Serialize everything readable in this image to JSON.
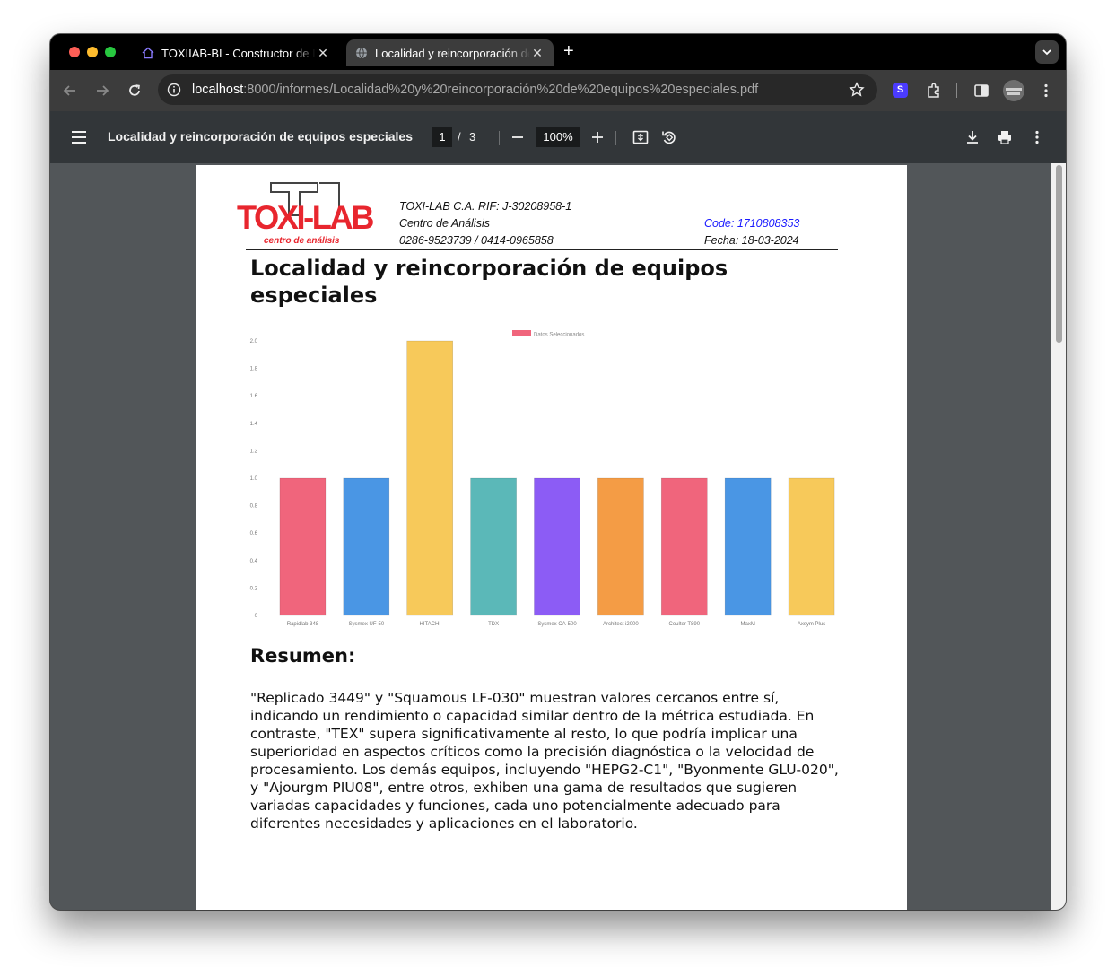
{
  "browser": {
    "tabs": [
      {
        "title": "TOXIIAB-BI - Constructor de I",
        "close": "✕"
      },
      {
        "title": "Localidad y reincorporación de equipos especiales",
        "close": "✕"
      }
    ],
    "new_tab": "+",
    "url_host": "localhost",
    "url_rest": ":8000/informes/Localidad%20y%20reincorporación%20de%20equipos%20especiales.pdf"
  },
  "pdf_toolbar": {
    "title": "Localidad y reincorporación de equipos especiales",
    "page_current": "1",
    "page_sep": "/",
    "page_total": "3",
    "zoom": "100%"
  },
  "document": {
    "logo_text": "TOXI-LAB",
    "logo_sub": "centro de análisis",
    "company_line": "TOXI-LAB C.A. RIF: J-30208958-1",
    "center_line": "Centro de Análisis",
    "phones": "0286-9523739 / 0414-0965858",
    "code": "Code: 1710808353",
    "date": "Fecha: 18-03-2024",
    "heading": "Localidad y reincorporación de equipos especiales",
    "summary_heading": "Resumen:",
    "summary_text": "\"Replicado 3449\" y \"Squamous LF-030\" muestran valores cercanos entre sí, indicando un rendimiento o capacidad similar dentro de la métrica estudiada. En contraste, \"TEX\" supera significativamente al resto, lo que podría implicar una superioridad en aspectos críticos como la precisión diagnóstica o la velocidad de procesamiento. Los demás equipos, incluyendo \"HEPG2-C1\", \"Byonmente GLU-020\", y \"Ajourgm PIU08\", entre otros, exhiben una gama de resultados que sugieren variadas capacidades y funciones, cada uno potencialmente adecuado para diferentes necesidades y aplicaciones en el laboratorio."
  },
  "colors": {
    "code_blue": "#1a1aff",
    "logo_red": "#e8262e"
  },
  "chart_data": {
    "type": "bar",
    "legend": "Datos Seleccionados",
    "legend_position": "top",
    "categories": [
      "Rapidlab 348",
      "Sysmex UF-50",
      "HITACHI",
      "TDX",
      "Sysmex CA-500",
      "Architect i2000",
      "Coulter T890",
      "MaxM",
      "Axsym Plus"
    ],
    "values": [
      1,
      1,
      2,
      1,
      1,
      1,
      1,
      1,
      1
    ],
    "colors": [
      "#f0657c",
      "#4a96e4",
      "#f7c95a",
      "#5bb8b8",
      "#8c5cf5",
      "#f49c45",
      "#f0657c",
      "#4a96e4",
      "#f7c95a"
    ],
    "yticks": [
      "0",
      "0.2",
      "0.4",
      "0.6",
      "0.8",
      "1.0",
      "1.2",
      "1.4",
      "1.6",
      "1.8",
      "2.0"
    ],
    "ylim": [
      0,
      2
    ],
    "grid": false
  }
}
